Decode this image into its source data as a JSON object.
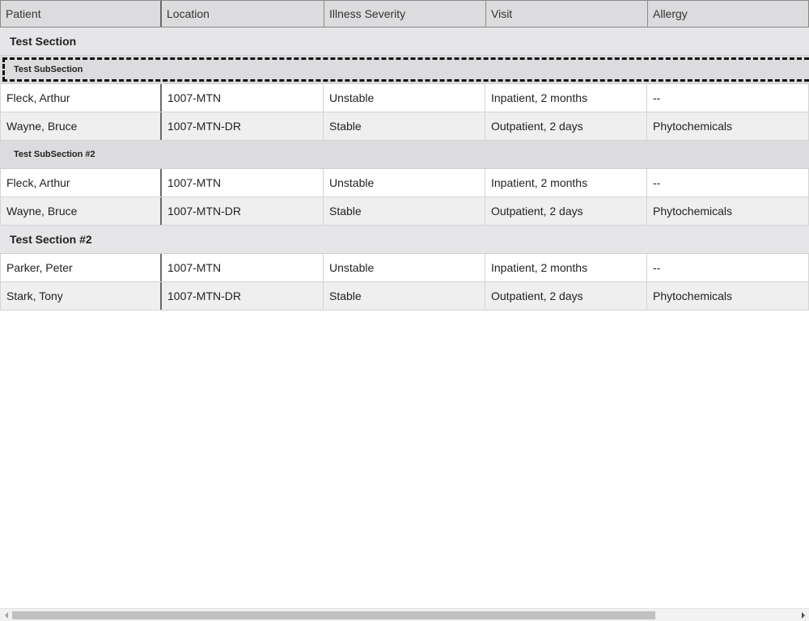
{
  "columns": [
    "Patient",
    "Location",
    "Illness Severity",
    "Visit",
    "Allergy"
  ],
  "sections": [
    {
      "title": "Test Section",
      "subsections": [
        {
          "title": "Test SubSection",
          "rows": [
            [
              "Fleck, Arthur",
              "1007-MTN",
              "Unstable",
              "Inpatient, 2 months",
              "--"
            ],
            [
              "Wayne, Bruce",
              "1007-MTN-DR",
              "Stable",
              "Outpatient, 2 days",
              "Phytochemicals"
            ]
          ]
        },
        {
          "title": "Test SubSection #2",
          "rows": [
            [
              "Fleck, Arthur",
              "1007-MTN",
              "Unstable",
              "Inpatient, 2 months",
              "--"
            ],
            [
              "Wayne, Bruce",
              "1007-MTN-DR",
              "Stable",
              "Outpatient, 2 days",
              "Phytochemicals"
            ]
          ]
        }
      ]
    },
    {
      "title": "Test Section #2",
      "rows": [
        [
          "Parker, Peter",
          "1007-MTN",
          "Unstable",
          "Inpatient, 2 months",
          "--"
        ],
        [
          "Stark, Tony",
          "1007-MTN-DR",
          "Stable",
          "Outpatient, 2 days",
          "Phytochemicals"
        ]
      ]
    }
  ],
  "scrollbar": {
    "horizontal_thumb_fraction": 0.82
  },
  "icons": {
    "scroll_left": "scroll-left-arrow-icon",
    "scroll_right": "scroll-right-arrow-icon"
  }
}
